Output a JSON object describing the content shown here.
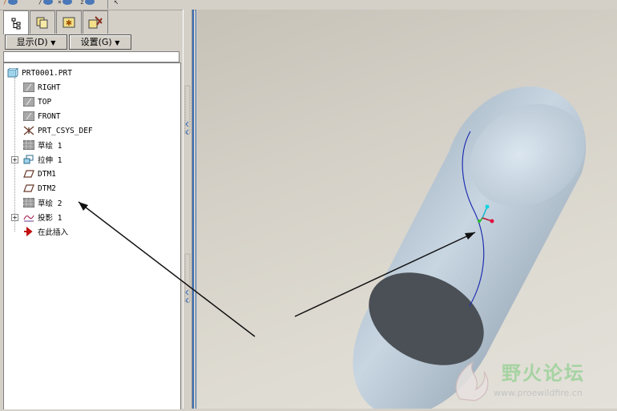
{
  "window": {
    "tabs": [
      {
        "name": "model-tree-tab",
        "icon": "tree-icon"
      },
      {
        "name": "folder-tab",
        "icon": "folder-browser-icon"
      },
      {
        "name": "favorites-tab",
        "icon": "favorites-icon"
      },
      {
        "name": "connections-tab",
        "icon": "tools-icon"
      }
    ]
  },
  "menubar": {
    "display_label": "显示(D)",
    "settings_label": "设置(G)"
  },
  "tree": {
    "items": [
      {
        "label": "PRT0001.PRT",
        "icon": "part-icon"
      },
      {
        "label": "RIGHT",
        "icon": "datum-plane-icon"
      },
      {
        "label": "TOP",
        "icon": "datum-plane-icon"
      },
      {
        "label": "FRONT",
        "icon": "datum-plane-icon"
      },
      {
        "label": "PRT_CSYS_DEF",
        "icon": "csys-icon"
      },
      {
        "label": "草绘 1",
        "icon": "sketch-icon"
      },
      {
        "label": "拉伸 1",
        "icon": "extrude-icon"
      },
      {
        "label": "DTM1",
        "icon": "datum-plane-outline-icon"
      },
      {
        "label": "DTM2",
        "icon": "datum-plane-outline-icon"
      },
      {
        "label": "草绘 2",
        "icon": "sketch-icon"
      },
      {
        "label": "投影 1",
        "icon": "projection-icon"
      },
      {
        "label": "在此插入",
        "icon": "insert-arrow-icon"
      }
    ]
  },
  "watermark": {
    "title": "野火论坛",
    "url": "www.proewildfire.cn"
  },
  "colors": {
    "cylinder": "#b9c8d6",
    "cylinder_end": "#4a4f55",
    "curve": "#1f2fb0",
    "selection_blue": "#3c6eb4"
  }
}
